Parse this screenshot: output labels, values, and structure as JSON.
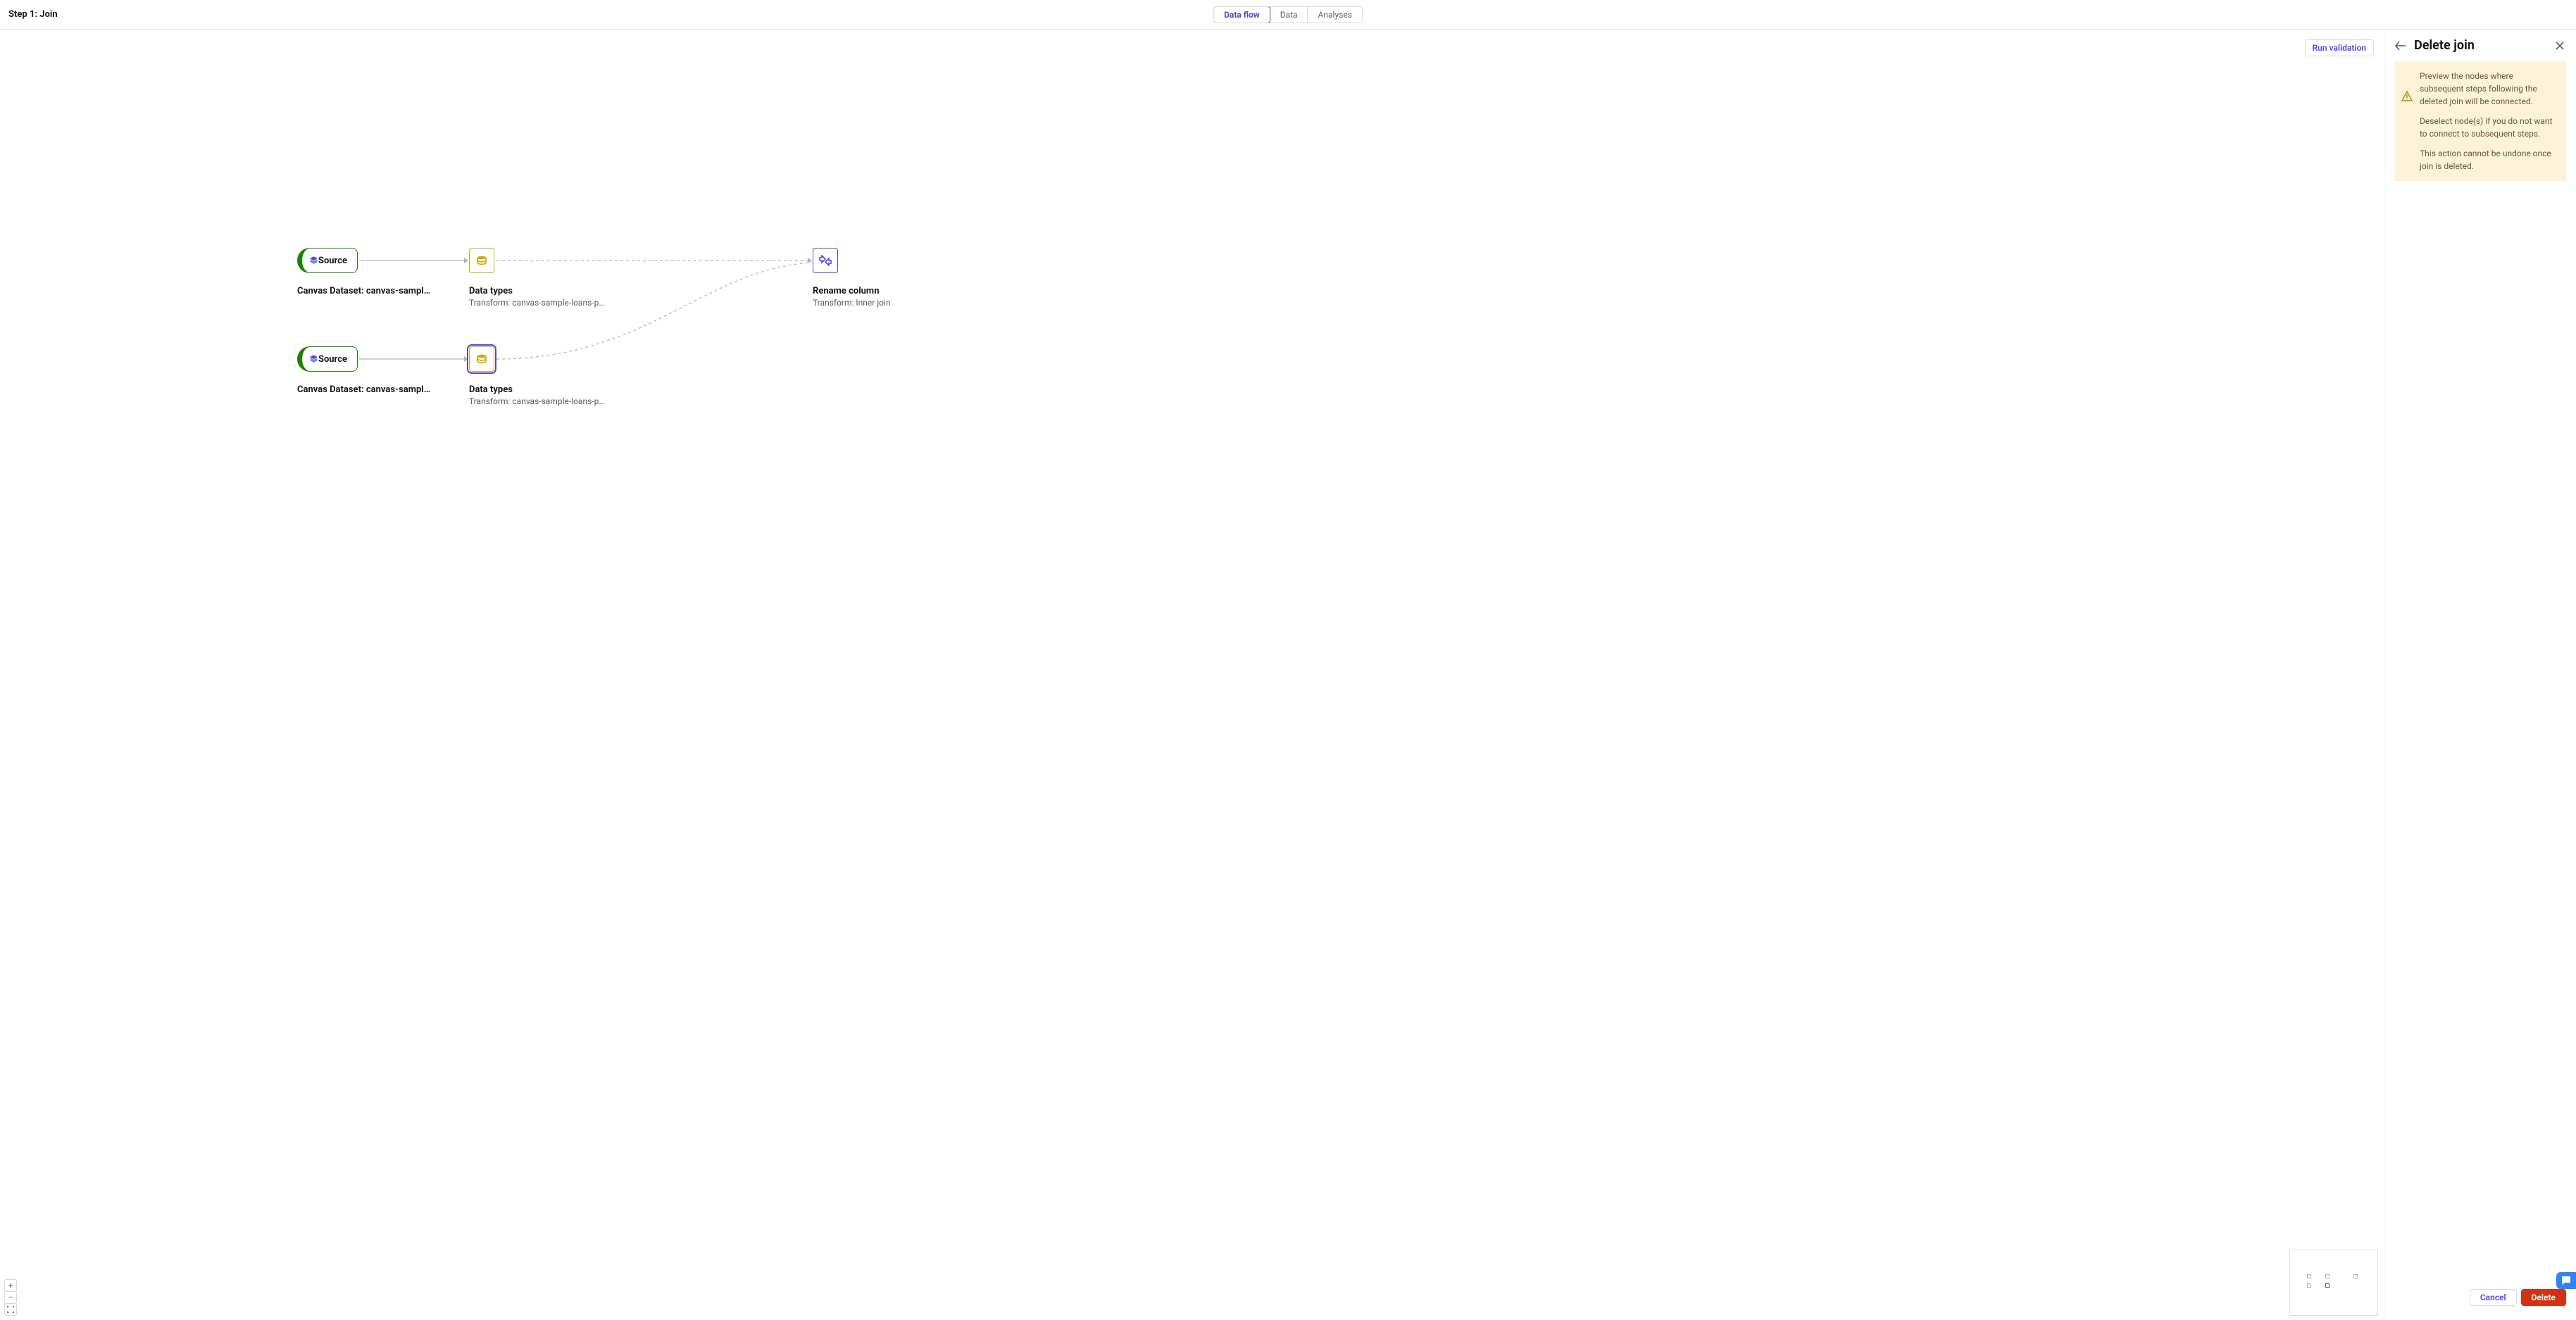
{
  "topbar": {
    "title": "Step 1: Join",
    "tabs": [
      "Data flow",
      "Data",
      "Analyses"
    ],
    "active_tab_index": 0
  },
  "canvas": {
    "run_validation_label": "Run validation",
    "nodes": {
      "source1": {
        "label": "Source",
        "title": "Canvas Dataset: canvas-sample-…"
      },
      "source2": {
        "label": "Source",
        "title": "Canvas Dataset: canvas-sample-…"
      },
      "datatypes1": {
        "title": "Data types",
        "sub": "Transform: canvas-sample-loans-part-…"
      },
      "datatypes2": {
        "title": "Data types",
        "sub": "Transform: canvas-sample-loans-part-…"
      },
      "rename": {
        "title": "Rename column",
        "sub": "Transform: Inner join"
      }
    },
    "zoom": {
      "in": "+",
      "out": "−",
      "full": "⛶"
    }
  },
  "side_panel": {
    "title": "Delete join",
    "warning_lines": [
      "Preview the nodes where subsequent steps following the deleted join will be connected.",
      "Deselect node(s) if you do not want to connect to subsequent steps.",
      "This action cannot be undone once join is deleted."
    ],
    "cancel_label": "Cancel",
    "delete_label": "Delete"
  }
}
